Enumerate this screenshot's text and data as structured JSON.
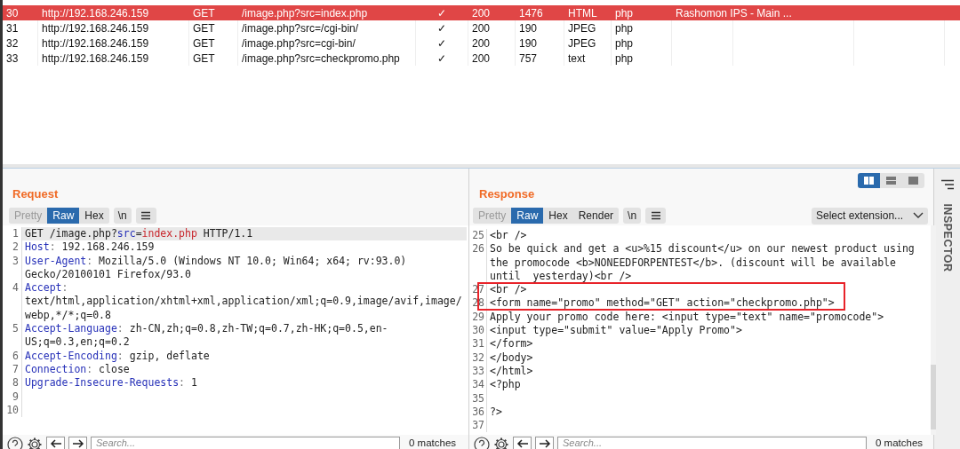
{
  "table": {
    "rows": [
      {
        "selected": true,
        "cells": [
          "30",
          "http://192.168.246.159",
          "GET",
          "/image.php?src=index.php",
          "✓",
          "200",
          "1476",
          "HTML",
          "php",
          "Rashomon IPS - Main ..."
        ]
      },
      {
        "selected": false,
        "cells": [
          "31",
          "http://192.168.246.159",
          "GET",
          "/image.php?src=/cgi-bin/",
          "✓",
          "200",
          "190",
          "JPEG",
          "php"
        ]
      },
      {
        "selected": false,
        "cells": [
          "32",
          "http://192.168.246.159",
          "GET",
          "/image.php?src=cgi-bin/",
          "✓",
          "200",
          "190",
          "JPEG",
          "php"
        ]
      },
      {
        "selected": false,
        "cells": [
          "33",
          "http://192.168.246.159",
          "GET",
          "/image.php?src=checkpromo.php",
          "✓",
          "200",
          "757",
          "text",
          "php"
        ]
      }
    ]
  },
  "request": {
    "title": "Request",
    "tabs": [
      {
        "label": "Pretty",
        "selected": false,
        "disabled": true
      },
      {
        "label": "Raw",
        "selected": true,
        "disabled": false
      },
      {
        "label": "Hex",
        "selected": false,
        "disabled": false
      }
    ],
    "newline_button": "\\n",
    "lines": [
      {
        "number": "1",
        "kind": "request_line",
        "selected": true,
        "method": "GET",
        "path": "/image.php?",
        "param": "src",
        "equals": "=",
        "param_value": "index.php",
        "protocol": "HTTP/1.1"
      },
      {
        "number": "2",
        "kind": "header",
        "selected": false,
        "name": "Host",
        "colon": ":",
        "value": "192.168.246.159"
      },
      {
        "number": "3",
        "kind": "header",
        "selected": false,
        "name": "User-Agent",
        "colon": ":",
        "value": "Mozilla/5.0 (Windows NT 10.0; Win64; x64; rv:93.0) Gecko/20100101 Firefox/93.0"
      },
      {
        "number": "4",
        "kind": "header",
        "selected": false,
        "name": "Accept",
        "colon": ":",
        "value": "text/html,application/xhtml+xml,application/xml;q=0.9,image/avif,image/webp,*/*;q=0.8"
      },
      {
        "number": "5",
        "kind": "header",
        "selected": false,
        "name": "Accept-Language",
        "colon": ":",
        "value": "zh-CN,zh;q=0.8,zh-TW;q=0.7,zh-HK;q=0.5,en-US;q=0.3,en;q=0.2"
      },
      {
        "number": "6",
        "kind": "header",
        "selected": false,
        "name": "Accept-Encoding",
        "colon": ":",
        "value": "gzip, deflate"
      },
      {
        "number": "7",
        "kind": "header",
        "selected": false,
        "name": "Connection",
        "colon": ":",
        "value": "close"
      },
      {
        "number": "8",
        "kind": "header",
        "selected": false,
        "name": "Upgrade-Insecure-Requests",
        "colon": ":",
        "value": "1"
      },
      {
        "number": "9",
        "kind": "blank",
        "selected": false
      },
      {
        "number": "10",
        "kind": "blank",
        "selected": false
      }
    ],
    "search": {
      "placeholder": "Search...",
      "matches": "0 matches"
    }
  },
  "response": {
    "title": "Response",
    "layout_toggles": [
      {
        "kind": "columns",
        "selected": true
      },
      {
        "kind": "rows",
        "selected": false
      },
      {
        "kind": "single",
        "selected": false
      }
    ],
    "tabs": [
      {
        "label": "Pretty",
        "selected": false,
        "disabled": true
      },
      {
        "label": "Raw",
        "selected": true,
        "disabled": false
      },
      {
        "label": "Hex",
        "selected": false,
        "disabled": false
      },
      {
        "label": "Render",
        "selected": false,
        "disabled": false
      }
    ],
    "newline_button": "\\n",
    "extension_select": "Select extension...",
    "lines": [
      {
        "number": "25",
        "text": "<br />"
      },
      {
        "number": "26",
        "text": "So be quick and get a <u>%15 discount</u> on our newest product using the promocode <b>NONEEDFORPENTEST</b>. (discount will be available until  yesterday)<br />"
      },
      {
        "number": "27",
        "text": "<br />"
      },
      {
        "number": "28",
        "text": "<form name=\"promo\" method=\"GET\" action=\"checkpromo.php\">"
      },
      {
        "number": "29",
        "text": "Apply your promo code here: <input type=\"text\" name=\"promocode\">"
      },
      {
        "number": "30",
        "text": "<input type=\"submit\" value=\"Apply Promo\">"
      },
      {
        "number": "31",
        "text": "</form>"
      },
      {
        "number": "32",
        "text": "</body>"
      },
      {
        "number": "33",
        "text": "</html>"
      },
      {
        "number": "34",
        "text": "<?php"
      },
      {
        "number": "35"
      },
      {
        "number": "36",
        "text": "?>"
      },
      {
        "number": "37"
      }
    ],
    "search": {
      "placeholder": "Search...",
      "matches": "0 matches"
    }
  },
  "inspector": {
    "label": "INSPECTOR"
  }
}
